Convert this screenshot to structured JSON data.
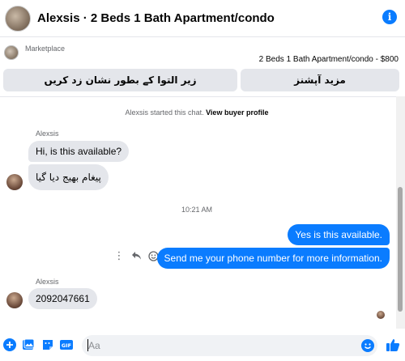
{
  "header": {
    "title": "Alexsis · 2 Beds 1 Bath Apartment/condo",
    "info_icon": "info-icon"
  },
  "marketplace": {
    "label": "Marketplace",
    "listing": "2 Beds 1 Bath Apartment/condo - $800",
    "buttons": [
      {
        "label": "زیر التوا کے بطور نشان زد کریں"
      },
      {
        "label": "مزید آپشنز"
      }
    ]
  },
  "chat": {
    "system_prefix": "Alexsis started this chat.",
    "system_link": "View buyer profile",
    "groups": [
      {
        "sender": "Alexsis",
        "messages": [
          "Hi, is this available?",
          "پیغام بھیج دیا گیا"
        ]
      }
    ],
    "timestamp": "10:21 AM",
    "outgoing": [
      "Yes is this available.",
      "Send me your phone number for more information."
    ],
    "second_group": {
      "sender": "Alexsis",
      "messages": [
        "2092047661"
      ]
    }
  },
  "composer": {
    "placeholder": "Aa",
    "icons": [
      "plus-icon",
      "photo-icon",
      "sticker-icon",
      "gif-icon",
      "emoji-icon",
      "like-icon"
    ]
  },
  "colors": {
    "accent": "#0a7cff",
    "incoming_bubble": "#e4e6eb",
    "muted_text": "#65676b"
  }
}
